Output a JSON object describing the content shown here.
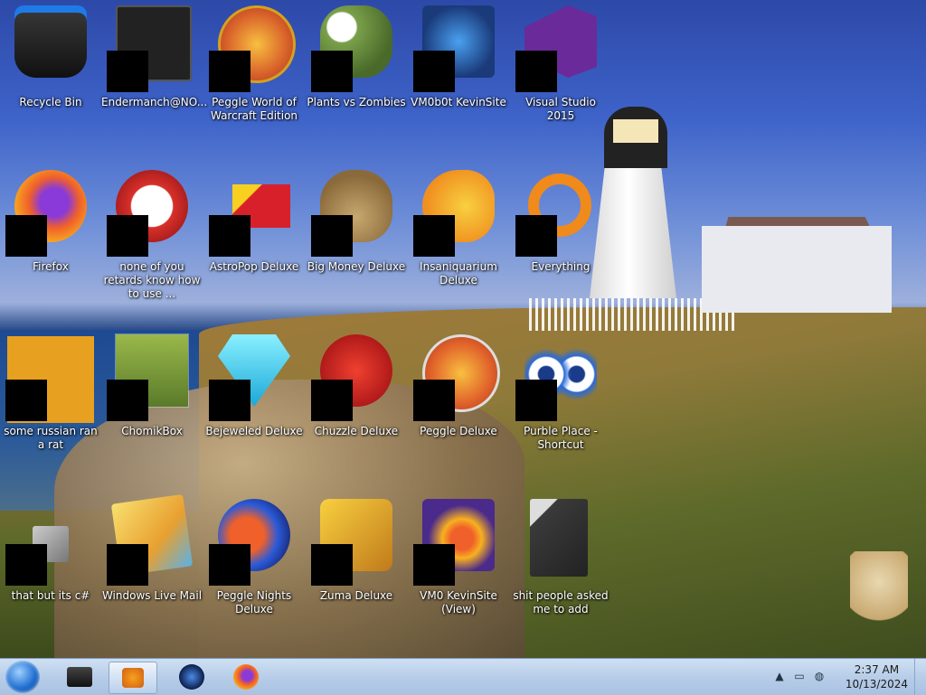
{
  "desktop": {
    "icons": [
      {
        "label": "Recycle Bin",
        "icon": "recycle-bin-icon",
        "color": "#1a1a1a"
      },
      {
        "label": "Endermanch@NO...",
        "icon": "document-icon",
        "color": "#2a2a2a"
      },
      {
        "label": "Peggle World of Warcraft Edition",
        "icon": "peggle-icon",
        "color": "#e8932a"
      },
      {
        "label": "Plants vs Zombies",
        "icon": "plants-vs-zombies-icon",
        "color": "#5a8a3a"
      },
      {
        "label": "VM0b0t KevinSite",
        "icon": "vm-icon",
        "color": "#1d5a9a"
      },
      {
        "label": "Visual Studio 2015",
        "icon": "visual-studio-icon",
        "color": "#6a2a9a"
      },
      {
        "label": "Firefox",
        "icon": "firefox-icon",
        "color": "#e8632a"
      },
      {
        "label": "none of you retards know how to use ...",
        "icon": "app-icon",
        "color": "#c02a20"
      },
      {
        "label": "AstroPop Deluxe",
        "icon": "astropop-icon",
        "color": "#d8202a"
      },
      {
        "label": "Big Money Deluxe",
        "icon": "money-bag-icon",
        "color": "#9a7a4a"
      },
      {
        "label": "Insaniquarium Deluxe",
        "icon": "fish-icon",
        "color": "#f2b42a"
      },
      {
        "label": "Everything",
        "icon": "search-ring-icon",
        "color": "#f08a1a"
      },
      {
        "label": "some russian ran a rat",
        "icon": "app-icon",
        "color": "#e8a020"
      },
      {
        "label": "ChomikBox",
        "icon": "chomikbox-icon",
        "color": "#6a8a3a"
      },
      {
        "label": "Bejeweled Deluxe",
        "icon": "gem-icon",
        "color": "#2ac8e8"
      },
      {
        "label": "Chuzzle Deluxe",
        "icon": "chuzzle-icon",
        "color": "#d8202a"
      },
      {
        "label": "Peggle Deluxe",
        "icon": "peggle-icon",
        "color": "#e8632a"
      },
      {
        "label": "Purble Place - Shortcut",
        "icon": "eyes-icon",
        "color": "#2a6ad8"
      },
      {
        "label": "that but its c#",
        "icon": "files-icon",
        "color": "#9a9a9a"
      },
      {
        "label": "Windows Live Mail",
        "icon": "mail-icon",
        "color": "#e8b040"
      },
      {
        "label": "Peggle Nights Deluxe",
        "icon": "peggle-icon",
        "color": "#2a5ad8"
      },
      {
        "label": "Zuma Deluxe",
        "icon": "zuma-icon",
        "color": "#d8a020"
      },
      {
        "label": "VM0 KevinSite (View)",
        "icon": "firefox-icon",
        "color": "#4a2a8a"
      },
      {
        "label": "shit people asked me to add",
        "icon": "folder-icon",
        "color": "#4a4a4a"
      }
    ]
  },
  "taskbar": {
    "start_label": "Start",
    "pinned": [
      {
        "name": "explorer",
        "icon": "folder-icon"
      },
      {
        "name": "media-player",
        "icon": "media-player-icon"
      },
      {
        "name": "vm",
        "icon": "globe-icon"
      },
      {
        "name": "firefox",
        "icon": "firefox-icon"
      }
    ],
    "tray": {
      "time": "2:37 AM",
      "date": "10/13/2024",
      "show_hidden": "▲"
    }
  }
}
